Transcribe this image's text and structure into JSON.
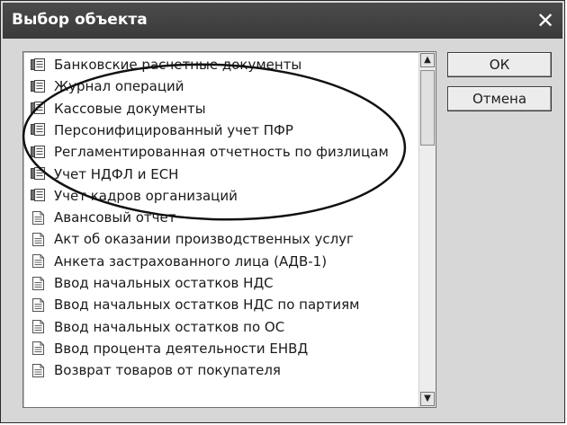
{
  "dialog": {
    "title": "Выбор объекта",
    "close_symbol": "✕",
    "ok_label": "ОК",
    "cancel_label": "Отмена"
  },
  "list": {
    "items": [
      {
        "label": "Банковские расчетные документы",
        "icon": "journal-icon"
      },
      {
        "label": "Журнал операций",
        "icon": "journal-icon"
      },
      {
        "label": "Кассовые документы",
        "icon": "journal-icon"
      },
      {
        "label": "Персонифицированный учет ПФР",
        "icon": "journal-icon"
      },
      {
        "label": "Регламентированная отчетность по физлицам",
        "icon": "journal-icon"
      },
      {
        "label": "Учет НДФЛ и ЕСН",
        "icon": "journal-icon"
      },
      {
        "label": "Учет кадров организаций",
        "icon": "journal-icon"
      },
      {
        "label": "Авансовый отчет",
        "icon": "document-icon"
      },
      {
        "label": "Акт об оказании производственных услуг",
        "icon": "document-icon"
      },
      {
        "label": "Анкета застрахованного лица (АДВ-1)",
        "icon": "document-icon"
      },
      {
        "label": "Ввод начальных остатков НДС",
        "icon": "document-icon"
      },
      {
        "label": "Ввод начальных остатков НДС по партиям",
        "icon": "document-icon"
      },
      {
        "label": "Ввод начальных остатков по ОС",
        "icon": "document-icon"
      },
      {
        "label": "Ввод процента деятельности ЕНВД",
        "icon": "document-icon"
      },
      {
        "label": "Возврат товаров от покупателя",
        "icon": "document-icon"
      }
    ]
  },
  "scrollbar": {
    "up_icon": "arrow-up-icon",
    "down_icon": "arrow-down-icon"
  },
  "colors": {
    "title_bg": "#3f3f3f",
    "title_text": "#ffffff",
    "dialog_bg": "#d7d7d7",
    "list_bg": "#ffffff"
  }
}
